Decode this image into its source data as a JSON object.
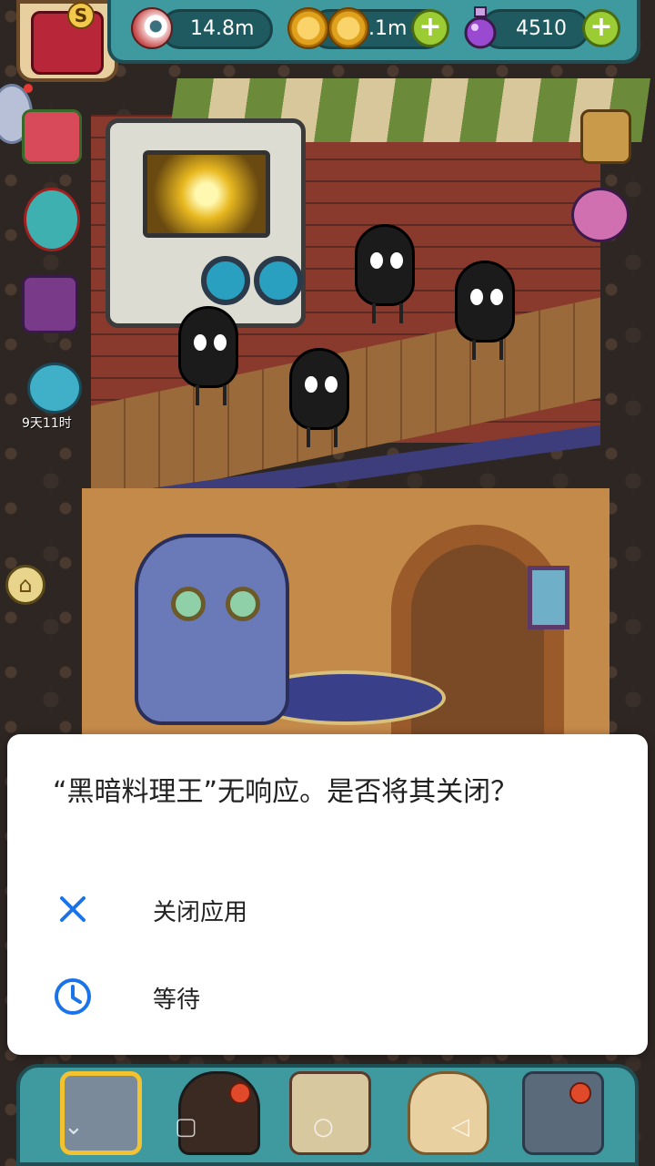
{
  "top_bar": {
    "eyes_value": "14.8m",
    "coins_value": ".1m",
    "potions_value": "4510",
    "badge_letter": "S"
  },
  "side": {
    "event_timer": "9天11时"
  },
  "dialog": {
    "title": "“黑暗料理王”无响应。是否将其关闭？",
    "close_app_label": "关闭应用",
    "wait_label": "等待"
  },
  "colors": {
    "accent_blue": "#1a73e8",
    "topbar_teal": "#3f9aa0",
    "plus_green": "#9ccc33"
  }
}
